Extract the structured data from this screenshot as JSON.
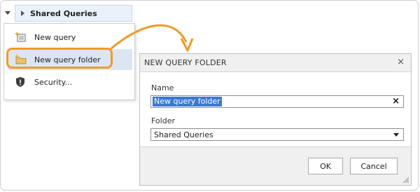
{
  "tree": {
    "header_label": "Shared Queries"
  },
  "context_menu": {
    "items": [
      {
        "label": "New query",
        "icon": "new-query-icon"
      },
      {
        "label": "New query folder",
        "icon": "new-folder-icon",
        "selected": true
      },
      {
        "label": "Security...",
        "icon": "shield-icon"
      }
    ]
  },
  "dialog": {
    "title": "NEW QUERY FOLDER",
    "name_label": "Name",
    "name_value": "New query folder",
    "folder_label": "Folder",
    "folder_value": "Shared Queries",
    "ok_label": "OK",
    "cancel_label": "Cancel"
  },
  "colors": {
    "accent_orange": "#f29a25",
    "selection_blue": "#3a78d6",
    "menu_highlight": "#dbe6f5"
  }
}
